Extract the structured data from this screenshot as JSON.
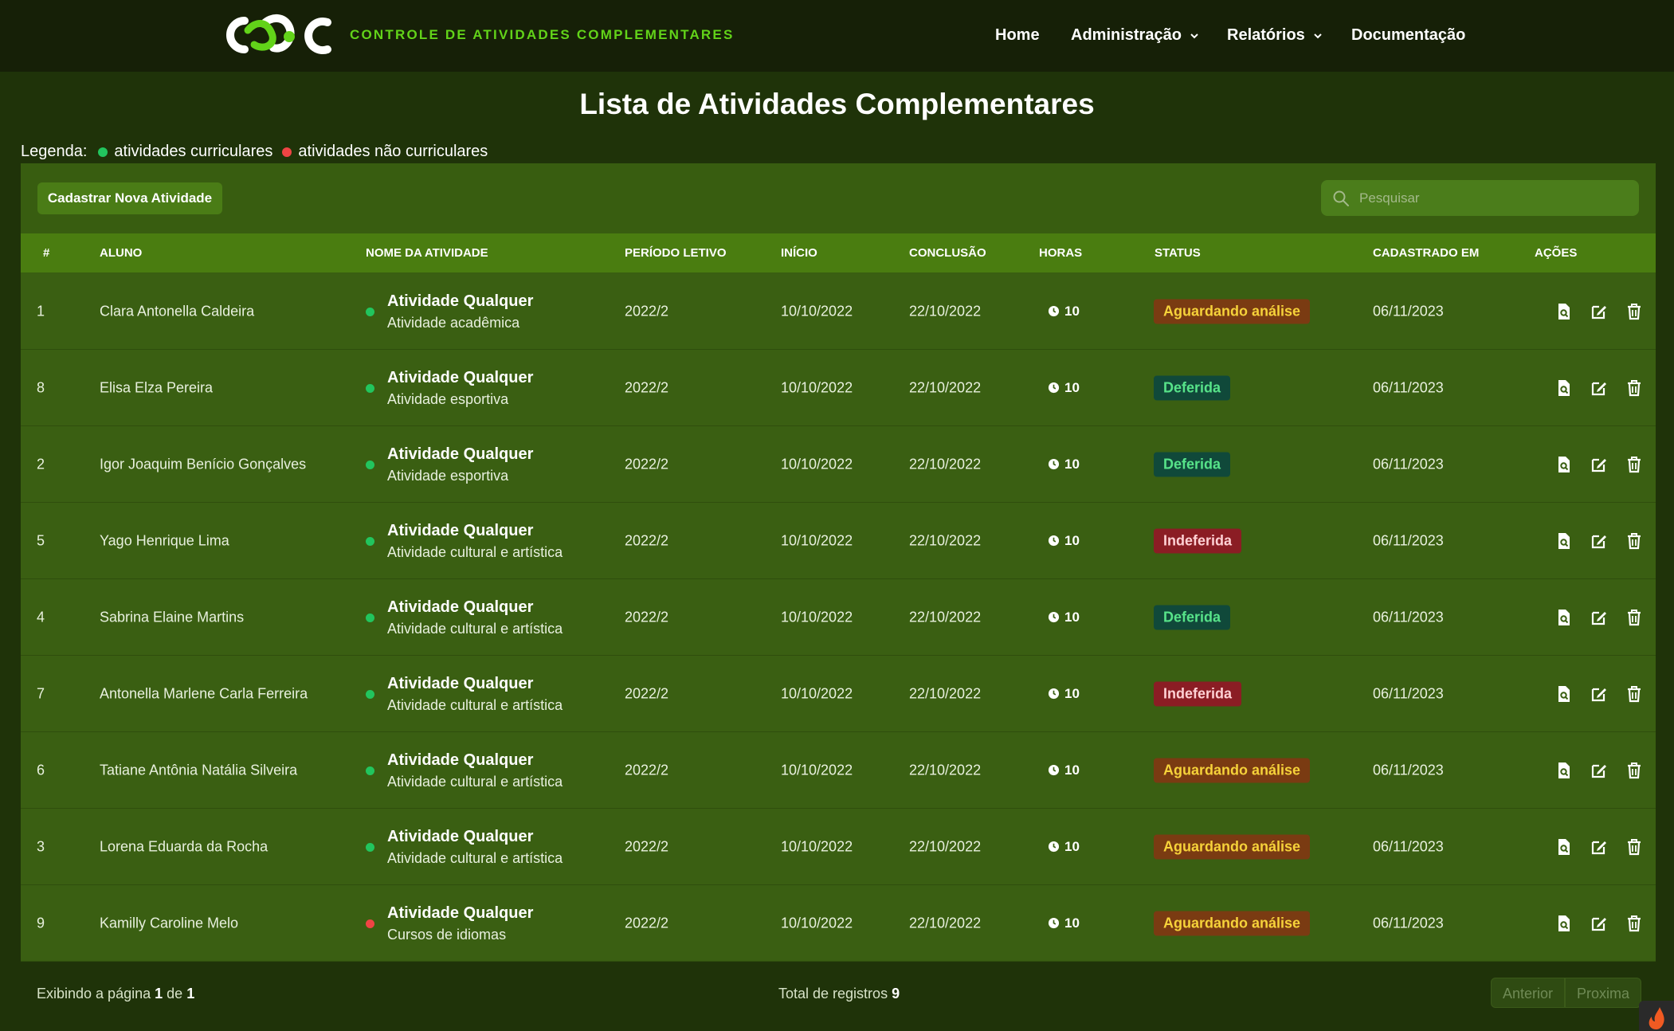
{
  "navbar": {
    "brand": "CONTROLE DE ATIVIDADES COMPLEMENTARES",
    "links": [
      "Home",
      "Administração",
      "Relatórios",
      "Documentação"
    ]
  },
  "page": {
    "title": "Lista de Atividades Complementares",
    "legend_label": "Legenda:",
    "legend_curricular": "atividades curriculares",
    "legend_non_curricular": "atividades não curriculares"
  },
  "toolbar": {
    "new_button": "Cadastrar Nova Atividade",
    "search_placeholder": "Pesquisar"
  },
  "table": {
    "headers": [
      "#",
      "ALUNO",
      "NOME DA ATIVIDADE",
      "PERÍODO LETIVO",
      "INÍCIO",
      "CONCLUSÃO",
      "HORAS",
      "STATUS",
      "CADASTRADO EM",
      "AÇÕES"
    ],
    "rows": [
      {
        "id": "1",
        "student": "Clara Antonella Caldeira",
        "activity": "Atividade Qualquer",
        "type": "Atividade acadêmica",
        "curricular": true,
        "period": "2022/2",
        "start": "10/10/2022",
        "end": "22/10/2022",
        "hours": "10",
        "status": "Aguardando análise",
        "status_kind": "pending",
        "created": "06/11/2023"
      },
      {
        "id": "8",
        "student": "Elisa Elza Pereira",
        "activity": "Atividade Qualquer",
        "type": "Atividade esportiva",
        "curricular": true,
        "period": "2022/2",
        "start": "10/10/2022",
        "end": "22/10/2022",
        "hours": "10",
        "status": "Deferida",
        "status_kind": "ok",
        "created": "06/11/2023"
      },
      {
        "id": "2",
        "student": "Igor Joaquim Benício Gonçalves",
        "activity": "Atividade Qualquer",
        "type": "Atividade esportiva",
        "curricular": true,
        "period": "2022/2",
        "start": "10/10/2022",
        "end": "22/10/2022",
        "hours": "10",
        "status": "Deferida",
        "status_kind": "ok",
        "created": "06/11/2023"
      },
      {
        "id": "5",
        "student": "Yago Henrique Lima",
        "activity": "Atividade Qualquer",
        "type": "Atividade cultural e artística",
        "curricular": true,
        "period": "2022/2",
        "start": "10/10/2022",
        "end": "22/10/2022",
        "hours": "10",
        "status": "Indeferida",
        "status_kind": "denied",
        "created": "06/11/2023"
      },
      {
        "id": "4",
        "student": "Sabrina Elaine Martins",
        "activity": "Atividade Qualquer",
        "type": "Atividade cultural e artística",
        "curricular": true,
        "period": "2022/2",
        "start": "10/10/2022",
        "end": "22/10/2022",
        "hours": "10",
        "status": "Deferida",
        "status_kind": "ok",
        "created": "06/11/2023"
      },
      {
        "id": "7",
        "student": "Antonella Marlene Carla Ferreira",
        "activity": "Atividade Qualquer",
        "type": "Atividade cultural e artística",
        "curricular": true,
        "period": "2022/2",
        "start": "10/10/2022",
        "end": "22/10/2022",
        "hours": "10",
        "status": "Indeferida",
        "status_kind": "denied",
        "created": "06/11/2023"
      },
      {
        "id": "6",
        "student": "Tatiane Antônia Natália Silveira",
        "activity": "Atividade Qualquer",
        "type": "Atividade cultural e artística",
        "curricular": true,
        "period": "2022/2",
        "start": "10/10/2022",
        "end": "22/10/2022",
        "hours": "10",
        "status": "Aguardando análise",
        "status_kind": "pending",
        "created": "06/11/2023"
      },
      {
        "id": "3",
        "student": "Lorena Eduarda da Rocha",
        "activity": "Atividade Qualquer",
        "type": "Atividade cultural e artística",
        "curricular": true,
        "period": "2022/2",
        "start": "10/10/2022",
        "end": "22/10/2022",
        "hours": "10",
        "status": "Aguardando análise",
        "status_kind": "pending",
        "created": "06/11/2023"
      },
      {
        "id": "9",
        "student": "Kamilly Caroline Melo",
        "activity": "Atividade Qualquer",
        "type": "Cursos de idiomas",
        "curricular": false,
        "period": "2022/2",
        "start": "10/10/2022",
        "end": "22/10/2022",
        "hours": "10",
        "status": "Aguardando análise",
        "status_kind": "pending",
        "created": "06/11/2023"
      }
    ]
  },
  "footer": {
    "page_prefix": "Exibindo a página",
    "page_current": "1",
    "page_of": "de",
    "page_total": "1",
    "total_label": "Total de registros",
    "total_value": "9",
    "prev": "Anterior",
    "next": "Proxima"
  },
  "icons": {
    "view": "file-search-icon",
    "edit": "edit-icon",
    "delete": "trash-icon",
    "hours": "clock-icon",
    "search": "search-icon",
    "dropdown": "chevron-down-icon"
  },
  "colors": {
    "brand": "#62d319",
    "curricular": "#22c55e",
    "non_curricular": "#ef4444",
    "pending": "#f6d23a",
    "approved": "#57e389",
    "denied": "#8b1d24"
  }
}
